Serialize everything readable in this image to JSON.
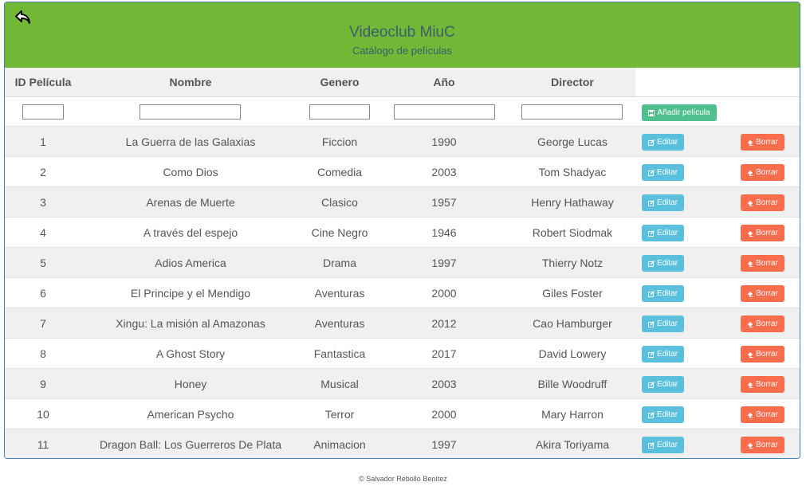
{
  "header": {
    "title": "Videoclub MiuC",
    "subtitle": "Catálogo de películas",
    "back_icon": "back-arrow-icon"
  },
  "table": {
    "columns": [
      "ID Película",
      "Nombre",
      "Genero",
      "Año",
      "Director"
    ],
    "add_label": "Añadir película",
    "edit_label": "Editar",
    "delete_label": "Borrar",
    "rows": [
      {
        "id": "1",
        "nombre": "La Guerra de las Galaxias",
        "genero": "Ficcion",
        "anio": "1990",
        "director": "George Lucas"
      },
      {
        "id": "2",
        "nombre": "Como Dios",
        "genero": "Comedia",
        "anio": "2003",
        "director": "Tom Shadyac"
      },
      {
        "id": "3",
        "nombre": "Arenas de Muerte",
        "genero": "Clasico",
        "anio": "1957",
        "director": "Henry Hathaway"
      },
      {
        "id": "4",
        "nombre": "A través del espejo",
        "genero": "Cine Negro",
        "anio": "1946",
        "director": "Robert Siodmak"
      },
      {
        "id": "5",
        "nombre": "Adios America",
        "genero": "Drama",
        "anio": "1997",
        "director": "Thierry Notz"
      },
      {
        "id": "6",
        "nombre": "El Principe y el Mendigo",
        "genero": "Aventuras",
        "anio": "2000",
        "director": "Giles Foster"
      },
      {
        "id": "7",
        "nombre": "Xingu: La misión al Amazonas",
        "genero": "Aventuras",
        "anio": "2012",
        "director": "Cao Hamburger"
      },
      {
        "id": "8",
        "nombre": "A Ghost Story",
        "genero": "Fantastica",
        "anio": "2017",
        "director": "David Lowery"
      },
      {
        "id": "9",
        "nombre": "Honey",
        "genero": "Musical",
        "anio": "2003",
        "director": "Bille Woodruff"
      },
      {
        "id": "10",
        "nombre": "American Psycho",
        "genero": "Terror",
        "anio": "2000",
        "director": "Mary Harron"
      },
      {
        "id": "11",
        "nombre": "Dragon Ball: Los Guerreros De Plata",
        "genero": "Animacion",
        "anio": "1997",
        "director": "Akira Toriyama"
      }
    ]
  },
  "footer": {
    "text": "© Salvador Rebollo Benítez"
  },
  "colors": {
    "header_bg": "#72b736",
    "add_button": "#4fc08d",
    "edit_button": "#5bc0de",
    "delete_button": "#f96d4c",
    "title_color": "#3c5e6e"
  }
}
